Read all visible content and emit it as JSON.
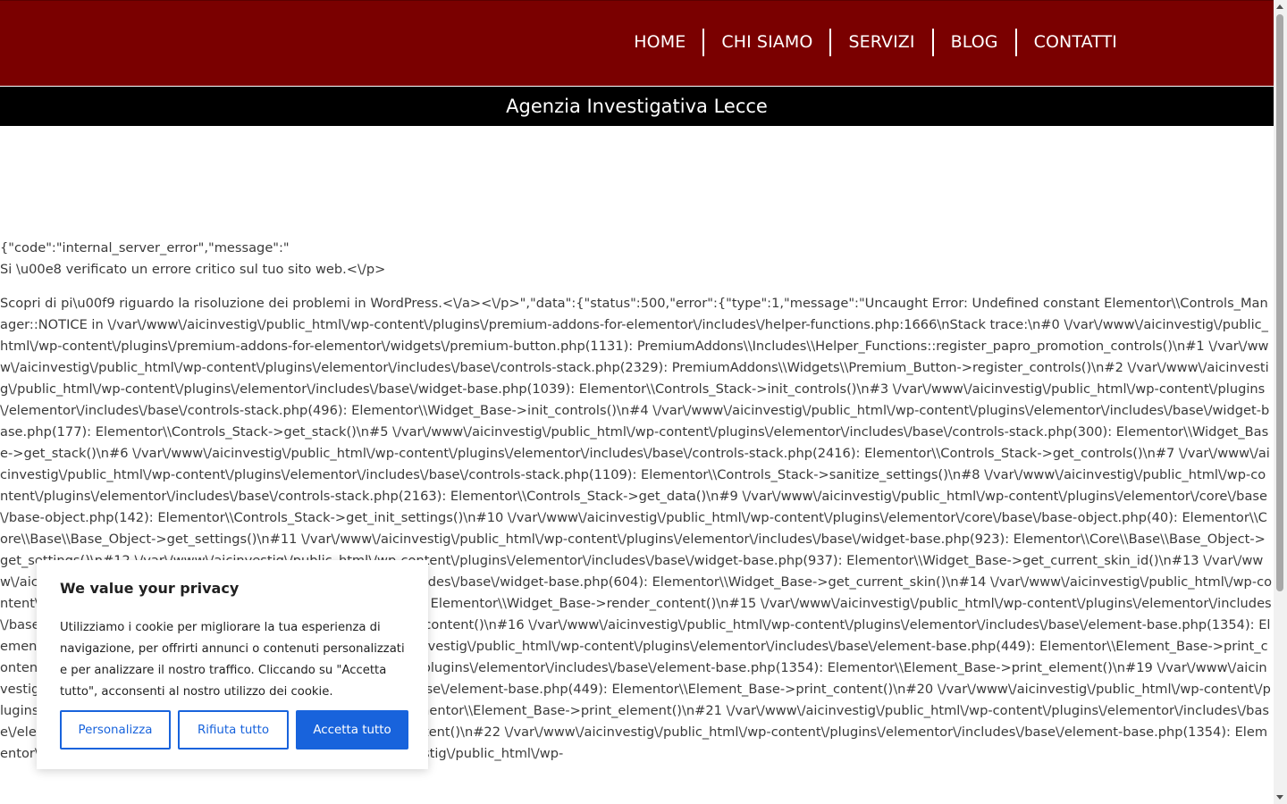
{
  "nav": {
    "items": [
      "HOME",
      "CHI SIAMO",
      "SERVIZI",
      "BLOG",
      "CONTATTI"
    ]
  },
  "banner": {
    "title": "Agenzia Investigativa Lecce"
  },
  "error": {
    "line1": "{\"code\":\"internal_server_error\",\"message\":\"",
    "line2": "Si \\u00e8 verificato un errore critico sul tuo sito web.<\\/p>",
    "body": "Scopri di pi\\u00f9 riguardo la risoluzione dei problemi in WordPress.<\\/a><\\/p>\",\"data\":{\"status\":500,\"error\":{\"type\":1,\"message\":\"Uncaught Error: Undefined constant Elementor\\\\Controls_Manager::NOTICE in \\/var\\/www\\/aicinvestig\\/public_html\\/wp-content\\/plugins\\/premium-addons-for-elementor\\/includes\\/helper-functions.php:1666\\nStack trace:\\n#0 \\/var\\/www\\/aicinvestig\\/public_html\\/wp-content\\/plugins\\/premium-addons-for-elementor\\/widgets\\/premium-button.php(1131): PremiumAddons\\\\Includes\\\\Helper_Functions::register_papro_promotion_controls()\\n#1 \\/var\\/www\\/aicinvestig\\/public_html\\/wp-content\\/plugins\\/elementor\\/includes\\/base\\/controls-stack.php(2329): PremiumAddons\\\\Widgets\\\\Premium_Button->register_controls()\\n#2 \\/var\\/www\\/aicinvestig\\/public_html\\/wp-content\\/plugins\\/elementor\\/includes\\/base\\/widget-base.php(1039): Elementor\\\\Controls_Stack->init_controls()\\n#3 \\/var\\/www\\/aicinvestig\\/public_html\\/wp-content\\/plugins\\/elementor\\/includes\\/base\\/controls-stack.php(496): Elementor\\\\Widget_Base->init_controls()\\n#4 \\/var\\/www\\/aicinvestig\\/public_html\\/wp-content\\/plugins\\/elementor\\/includes\\/base\\/widget-base.php(177): Elementor\\\\Controls_Stack->get_stack()\\n#5 \\/var\\/www\\/aicinvestig\\/public_html\\/wp-content\\/plugins\\/elementor\\/includes\\/base\\/controls-stack.php(300): Elementor\\\\Widget_Base->get_stack()\\n#6 \\/var\\/www\\/aicinvestig\\/public_html\\/wp-content\\/plugins\\/elementor\\/includes\\/base\\/controls-stack.php(2416): Elementor\\\\Controls_Stack->get_controls()\\n#7 \\/var\\/www\\/aicinvestig\\/public_html\\/wp-content\\/plugins\\/elementor\\/includes\\/base\\/controls-stack.php(1109): Elementor\\\\Controls_Stack->sanitize_settings()\\n#8 \\/var\\/www\\/aicinvestig\\/public_html\\/wp-content\\/plugins\\/elementor\\/includes\\/base\\/controls-stack.php(2163): Elementor\\\\Controls_Stack->get_data()\\n#9 \\/var\\/www\\/aicinvestig\\/public_html\\/wp-content\\/plugins\\/elementor\\/core\\/base\\/base-object.php(142): Elementor\\\\Controls_Stack->get_init_settings()\\n#10 \\/var\\/www\\/aicinvestig\\/public_html\\/wp-content\\/plugins\\/elementor\\/core\\/base\\/base-object.php(40): Elementor\\\\Core\\\\Base\\\\Base_Object->get_settings()\\n#11 \\/var\\/www\\/aicinvestig\\/public_html\\/wp-content\\/plugins\\/elementor\\/includes\\/base\\/widget-base.php(923): Elementor\\\\Core\\\\Base\\\\Base_Object->get_settings()\\n#12 \\/var\\/www\\/aicinvestig\\/public_html\\/wp-content\\/plugins\\/elementor\\/includes\\/base\\/widget-base.php(937): Elementor\\\\Widget_Base->get_current_skin_id()\\n#13 \\/var\\/www\\/aicinvestig\\/public_html\\/wp-content\\/plugins\\/elementor\\/includes\\/base\\/widget-base.php(604): Elementor\\\\Widget_Base->get_current_skin()\\n#14 \\/var\\/www\\/aicinvestig\\/public_html\\/wp-content\\/plugins\\/elementor\\/includes\\/base\\/widget-base.php(750): Elementor\\\\Widget_Base->render_content()\\n#15 \\/var\\/www\\/aicinvestig\\/public_html\\/wp-content\\/plugins\\/elementor\\/includes\\/base\\/element-base.php(449): Elementor\\\\Widget_Base->print_content()\\n#16 \\/var\\/www\\/aicinvestig\\/public_html\\/wp-content\\/plugins\\/elementor\\/includes\\/base\\/element-base.php(1354): Elementor\\\\Element_Base->print_element()\\n#17 \\/var\\/www\\/aicinvestig\\/public_html\\/wp-content\\/plugins\\/elementor\\/includes\\/base\\/element-base.php(449): Elementor\\\\Element_Base->print_content()\\n#18 \\/var\\/www\\/aicinvestig\\/public_html\\/wp-content\\/plugins\\/elementor\\/includes\\/base\\/element-base.php(1354): Elementor\\\\Element_Base->print_element()\\n#19 \\/var\\/www\\/aicinvestig\\/public_html\\/wp-content\\/plugins\\/elementor\\/includes\\/base\\/element-base.php(449): Elementor\\\\Element_Base->print_content()\\n#20 \\/var\\/www\\/aicinvestig\\/public_html\\/wp-content\\/plugins\\/elementor\\/includes\\/base\\/element-base.php(1354): Elementor\\\\Element_Base->print_element()\\n#21 \\/var\\/www\\/aicinvestig\\/public_html\\/wp-content\\/plugins\\/elementor\\/includes\\/base\\/element-base.php(449): Elementor\\\\Element_Base->print_content()\\n#22 \\/var\\/www\\/aicinvestig\\/public_html\\/wp-content\\/plugins\\/elementor\\/includes\\/base\\/element-base.php(1354): Elementor\\\\Element_Base->print_element()\\n#23 \\/var\\/www\\/aicinvestig\\/public_html\\/wp-"
  },
  "cookie_banner": {
    "title": "We value your privacy",
    "description": "Utilizziamo i cookie per migliorare la tua esperienza di navigazione, per offrirti annunci o contenuti personalizzati e per analizzare il nostro traffico. Cliccando su \"Accetta tutto\", acconsenti al nostro utilizzo dei cookie.",
    "customize_label": "Personalizza",
    "reject_label": "Rifiuta tutto",
    "accept_label": "Accetta tutto"
  },
  "colors": {
    "header_bg": "#7a0000",
    "subbar_bg": "#000000",
    "accent_blue": "#1863dc"
  }
}
